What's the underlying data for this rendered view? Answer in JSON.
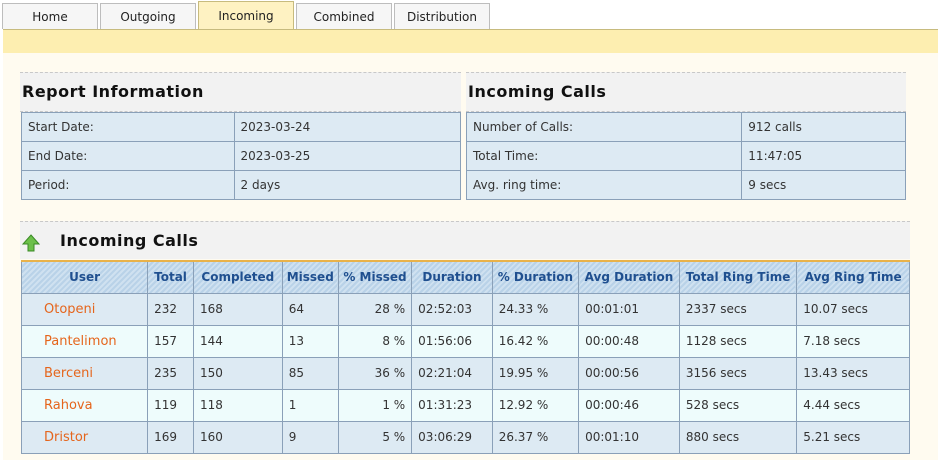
{
  "tabs": [
    {
      "label": "Home"
    },
    {
      "label": "Outgoing"
    },
    {
      "label": "Incoming"
    },
    {
      "label": "Combined"
    },
    {
      "label": "Distribution"
    }
  ],
  "report_info": {
    "title": "Report Information",
    "rows": [
      {
        "label": "Start Date:",
        "value": "2023-03-24"
      },
      {
        "label": "End Date:",
        "value": "2023-03-25"
      },
      {
        "label": "Period:",
        "value": "2 days"
      }
    ]
  },
  "incoming_summary": {
    "title": "Incoming Calls",
    "rows": [
      {
        "label": "Number of Calls:",
        "value": "912 calls"
      },
      {
        "label": "Total Time:",
        "value": "11:47:05"
      },
      {
        "label": "Avg. ring time:",
        "value": "9 secs"
      }
    ]
  },
  "calls_table": {
    "title": "Incoming Calls",
    "headers": [
      "User",
      "Total",
      "Completed",
      "Missed",
      "% Missed",
      "Duration",
      "% Duration",
      "Avg Duration",
      "Total Ring Time",
      "Avg Ring Time"
    ],
    "rows": [
      {
        "user": "Otopeni",
        "total": "232",
        "completed": "168",
        "missed": "64",
        "pct_missed": "28 %",
        "duration": "02:52:03",
        "pct_duration": "24.33 %",
        "avg_duration": "00:01:01",
        "total_ring": "2337 secs",
        "avg_ring": "10.07 secs"
      },
      {
        "user": "Pantelimon",
        "total": "157",
        "completed": "144",
        "missed": "13",
        "pct_missed": "8 %",
        "duration": "01:56:06",
        "pct_duration": "16.42 %",
        "avg_duration": "00:00:48",
        "total_ring": "1128 secs",
        "avg_ring": "7.18 secs"
      },
      {
        "user": "Berceni",
        "total": "235",
        "completed": "150",
        "missed": "85",
        "pct_missed": "36 %",
        "duration": "02:21:04",
        "pct_duration": "19.95 %",
        "avg_duration": "00:00:56",
        "total_ring": "3156 secs",
        "avg_ring": "13.43 secs"
      },
      {
        "user": "Rahova",
        "total": "119",
        "completed": "118",
        "missed": "1",
        "pct_missed": "1 %",
        "duration": "01:31:23",
        "pct_duration": "12.92 %",
        "avg_duration": "00:00:46",
        "total_ring": "528 secs",
        "avg_ring": "4.44 secs"
      },
      {
        "user": "Dristor",
        "total": "169",
        "completed": "160",
        "missed": "9",
        "pct_missed": "5 %",
        "duration": "03:06:29",
        "pct_duration": "26.37 %",
        "avg_duration": "00:01:10",
        "total_ring": "880 secs",
        "avg_ring": "5.21 secs"
      }
    ]
  },
  "colors": {
    "tab_strip": "#fdeeb0",
    "user_link": "#e5651c",
    "header_text": "#1f4f8f"
  }
}
